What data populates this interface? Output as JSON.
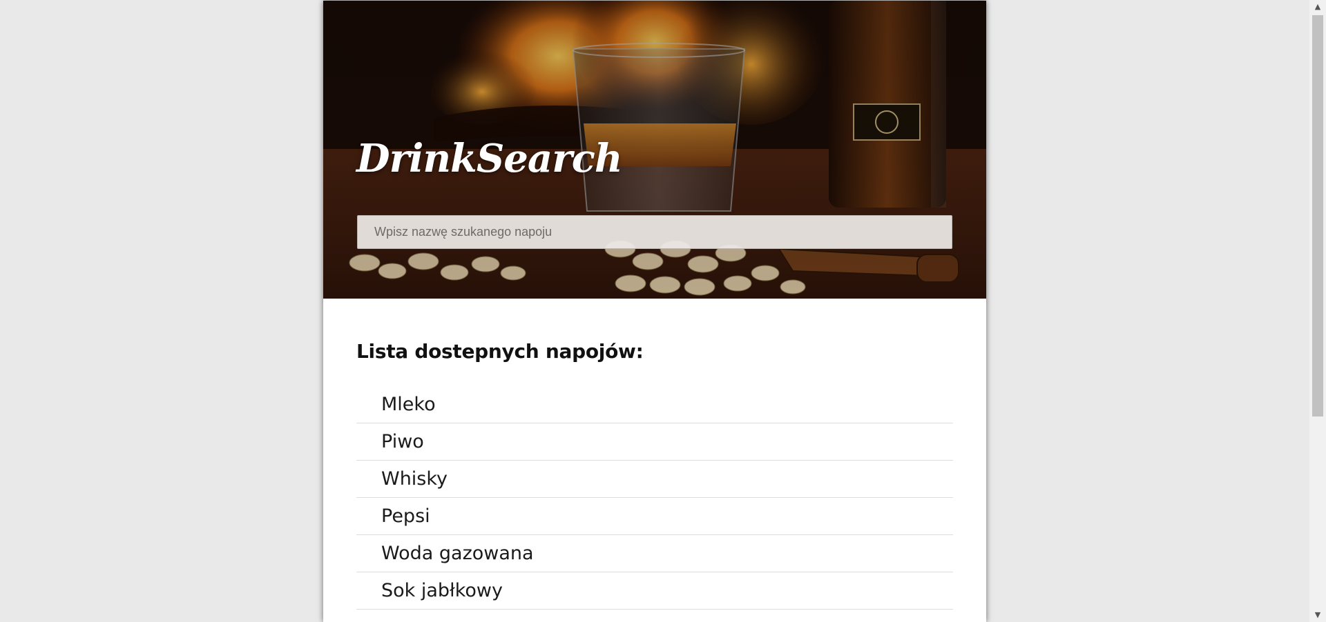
{
  "app": {
    "logo_text": "DrinkSearch"
  },
  "search": {
    "placeholder": "Wpisz nazwę szukanego napoju",
    "value": ""
  },
  "list": {
    "title": "Lista dostepnych napojów:",
    "items": [
      "Mleko",
      "Piwo",
      "Whisky",
      "Pepsi",
      "Woda gazowana",
      "Sok jabłkowy"
    ]
  },
  "scrollbar": {
    "up_glyph": "▲",
    "down_glyph": "▼"
  },
  "colors": {
    "page_background": "#e9e9e9",
    "card_background": "#ffffff",
    "text": "#1a1a1a",
    "hero_dark": "#1a0d07",
    "fire": "#f08a1a"
  },
  "icons": [
    "scroll-up-arrow-icon",
    "scroll-down-arrow-icon"
  ]
}
